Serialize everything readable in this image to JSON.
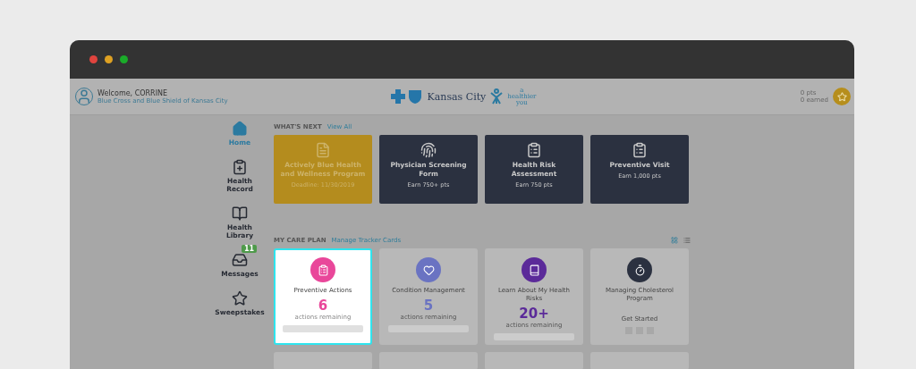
{
  "header": {
    "welcome": "Welcome, CORRINE",
    "organization": "Blue Cross and Blue Shield of Kansas City",
    "brand": "Kansas City",
    "tagline": [
      "a",
      "healthier",
      "you"
    ],
    "points": "0 pts",
    "earned": "0 earned"
  },
  "sidebar": {
    "items": [
      {
        "label": "Home",
        "kind": "home",
        "selected": true
      },
      {
        "label": "Health Record",
        "kind": "record",
        "selected": false
      },
      {
        "label": "Health Library",
        "kind": "library",
        "selected": false
      },
      {
        "label": "Messages",
        "kind": "messages",
        "selected": false,
        "badge": "11"
      },
      {
        "label": "Sweepstakes",
        "kind": "sweepstakes",
        "selected": false
      }
    ]
  },
  "whats_next": {
    "title": "WHAT'S NEXT",
    "link": "View All",
    "cards": [
      {
        "kind": "featured",
        "title": "Actively Blue Health and Wellness Program",
        "subtitle": "Deadline: 11/30/2019"
      },
      {
        "kind": "task",
        "title": "Physician Screening Form",
        "subtitle": "Earn 750+ pts"
      },
      {
        "kind": "task",
        "title": "Health Risk Assessment",
        "subtitle": "Earn 750 pts"
      },
      {
        "kind": "task",
        "title": "Preventive Visit",
        "subtitle": "Earn 1,000 pts"
      }
    ]
  },
  "care_plan": {
    "title": "MY CARE PLAN",
    "link": "Manage Tracker Cards",
    "views": [
      {
        "kind": "grid",
        "selected": true
      },
      {
        "kind": "list",
        "selected": false
      }
    ],
    "cards": [
      {
        "kind": "counter",
        "color": "#e9479a",
        "title": "Preventive Actions",
        "count": "6",
        "caption": "actions remaining",
        "selected": true
      },
      {
        "kind": "counter",
        "color": "#6a73c2",
        "title": "Condition Management",
        "count": "5",
        "caption": "actions remaining",
        "selected": false
      },
      {
        "kind": "counter",
        "color": "#5b2a99",
        "title": "Learn About My Health Risks",
        "count": "20+",
        "caption": "actions remaining",
        "selected": false
      },
      {
        "kind": "start",
        "color": "#2b3140",
        "title": "Managing Cholesterol Program",
        "action": "Get Started",
        "selected": false
      }
    ]
  }
}
